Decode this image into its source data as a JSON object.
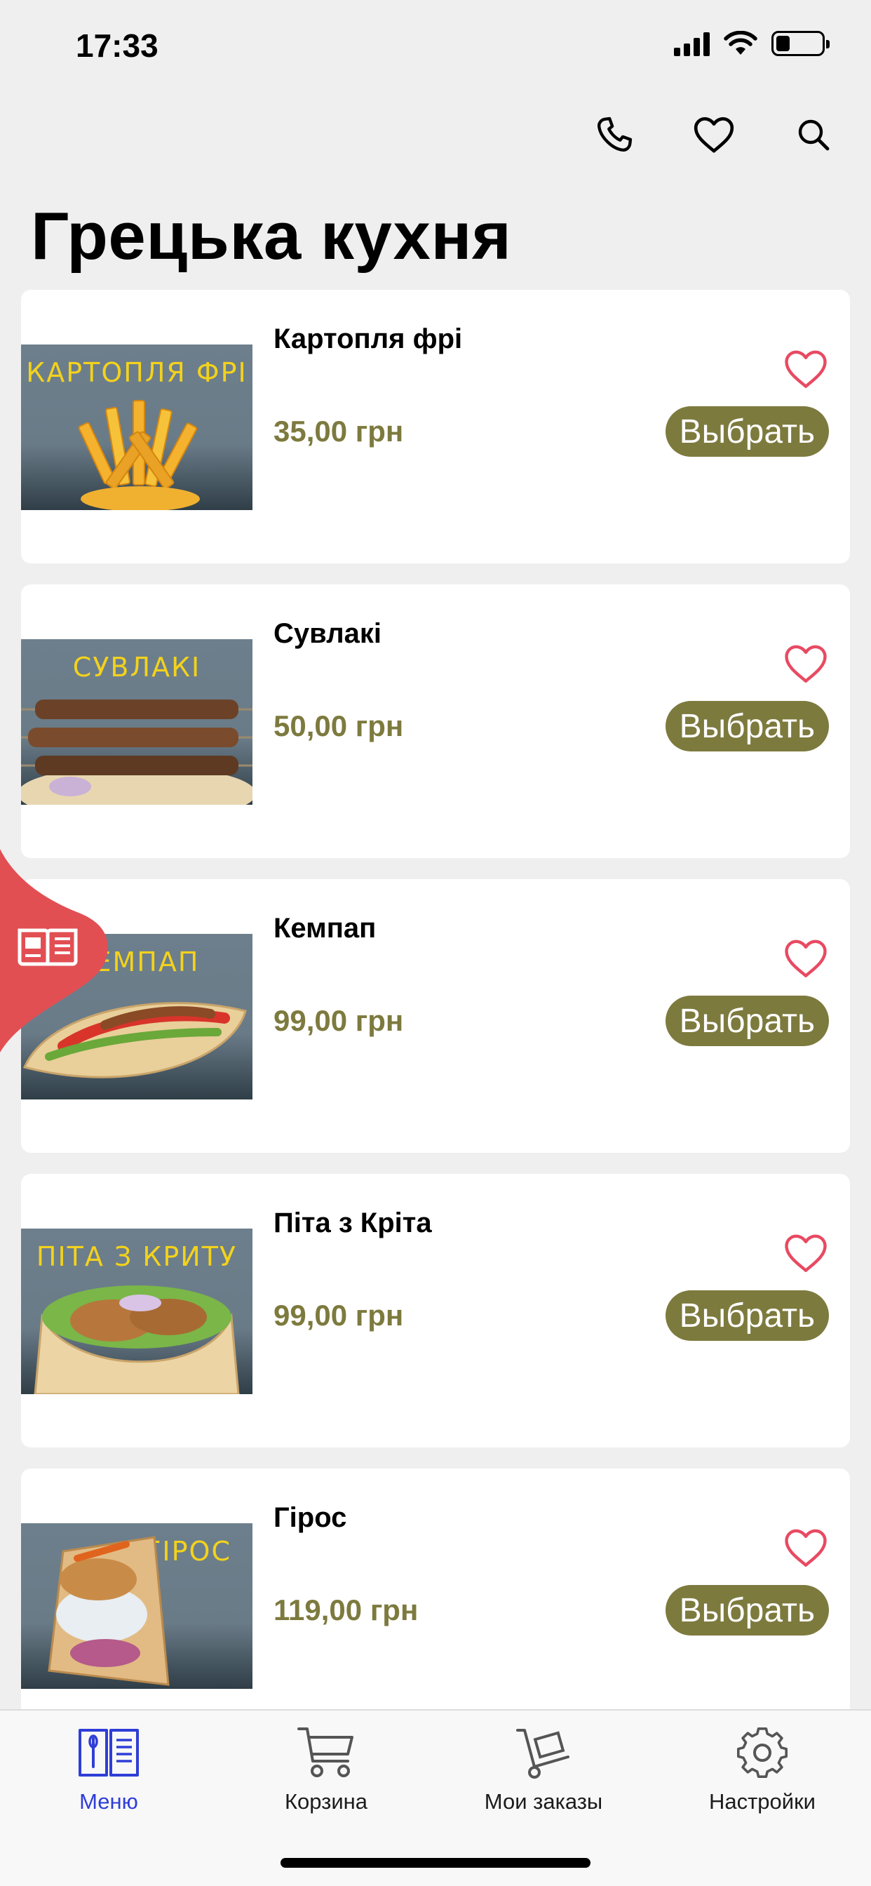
{
  "status": {
    "time": "17:33"
  },
  "header": {
    "title": "Грецька кухня",
    "actions": [
      {
        "icon": "phone-icon"
      },
      {
        "icon": "heart-icon"
      },
      {
        "icon": "search-icon"
      }
    ]
  },
  "colors": {
    "accent": "#7d7a3e",
    "favorite": "#e84a62",
    "active_tab": "#2f3ed6",
    "side_tab": "#e24f53"
  },
  "items": [
    {
      "name": "Картопля фрі",
      "price": "35,00 грн",
      "image_caption": "КАРТОПЛЯ ФРІ",
      "button": "Выбрать"
    },
    {
      "name": "Сувлакі",
      "price": "50,00 грн",
      "image_caption": "СУВЛАКІ",
      "button": "Выбрать"
    },
    {
      "name": "Кемпап",
      "price": "99,00 грн",
      "image_caption": "КЕМПАП",
      "button": "Выбрать"
    },
    {
      "name": "Піта з Кріта",
      "price": "99,00 грн",
      "image_caption": "ПІТА З КРИТУ",
      "button": "Выбрать"
    },
    {
      "name": "Гірос",
      "price": "119,00 грн",
      "image_caption": "ГІРОС",
      "button": "Выбрать"
    }
  ],
  "side_tab": {
    "icon": "menu-book-icon"
  },
  "tabbar": {
    "tabs": [
      {
        "label": "Меню",
        "icon": "menu-book-icon",
        "active": true
      },
      {
        "label": "Корзина",
        "icon": "cart-icon",
        "active": false
      },
      {
        "label": "Мои заказы",
        "icon": "hand-truck-icon",
        "active": false
      },
      {
        "label": "Настройки",
        "icon": "gear-icon",
        "active": false
      }
    ]
  }
}
